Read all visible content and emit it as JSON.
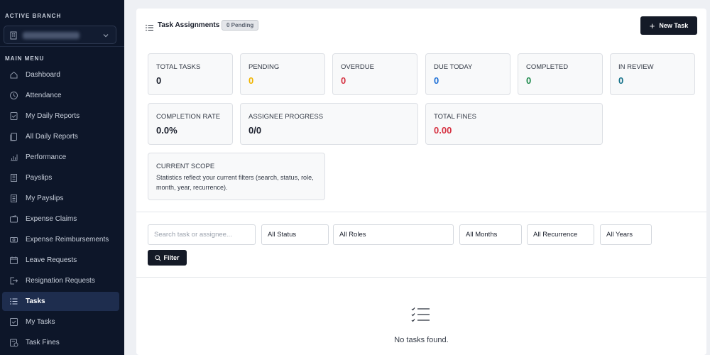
{
  "sidebar": {
    "active_branch_label": "ACTIVE BRANCH",
    "main_menu_label": "MAIN MENU",
    "items": [
      {
        "label": "Dashboard",
        "icon": "home-icon"
      },
      {
        "label": "Attendance",
        "icon": "clock-icon"
      },
      {
        "label": "My Daily Reports",
        "icon": "checklist-icon"
      },
      {
        "label": "All Daily Reports",
        "icon": "documents-icon"
      },
      {
        "label": "Performance",
        "icon": "bar-chart-icon"
      },
      {
        "label": "Payslips",
        "icon": "receipt-icon"
      },
      {
        "label": "My Payslips",
        "icon": "receipt-icon"
      },
      {
        "label": "Expense Claims",
        "icon": "wallet-icon"
      },
      {
        "label": "Expense Reimbursements",
        "icon": "cash-icon"
      },
      {
        "label": "Leave Requests",
        "icon": "calendar-icon"
      },
      {
        "label": "Resignation Requests",
        "icon": "exit-icon"
      },
      {
        "label": "Tasks",
        "icon": "task-list-icon",
        "active": true
      },
      {
        "label": "My Tasks",
        "icon": "check-square-icon"
      },
      {
        "label": "Task Fines",
        "icon": "fine-icon"
      }
    ]
  },
  "header": {
    "title": "Task Assignments",
    "pending_badge": "0 Pending",
    "new_task_label": "New Task"
  },
  "stats": {
    "total_tasks": {
      "label": "TOTAL TASKS",
      "value": "0"
    },
    "pending": {
      "label": "PENDING",
      "value": "0"
    },
    "overdue": {
      "label": "OVERDUE",
      "value": "0"
    },
    "due_today": {
      "label": "DUE TODAY",
      "value": "0"
    },
    "completed": {
      "label": "COMPLETED",
      "value": "0"
    },
    "in_review": {
      "label": "IN REVIEW",
      "value": "0"
    },
    "completion_rate": {
      "label": "COMPLETION RATE",
      "value": "0.0%"
    },
    "assignee_progress": {
      "label": "ASSIGNEE PROGRESS",
      "value": "0/0"
    },
    "total_fines": {
      "label": "TOTAL FINES",
      "value": "0.00"
    },
    "current_scope": {
      "label": "CURRENT SCOPE",
      "description": "Statistics reflect your current filters (search, status, role, month, year, recurrence)."
    }
  },
  "colors": {
    "pending": "#f0b400",
    "overdue": "#d63343",
    "due_today": "#1d6fd6",
    "completed": "#1e8a4c",
    "in_review": "#17728a",
    "total_fines": "#d63343"
  },
  "filters": {
    "search_placeholder": "Search task or assignee...",
    "status": "All Status",
    "roles": "All Roles",
    "months": "All Months",
    "recurrence": "All Recurrence",
    "years": "All Years",
    "filter_button": "Filter"
  },
  "empty_state": {
    "message": "No tasks found."
  }
}
